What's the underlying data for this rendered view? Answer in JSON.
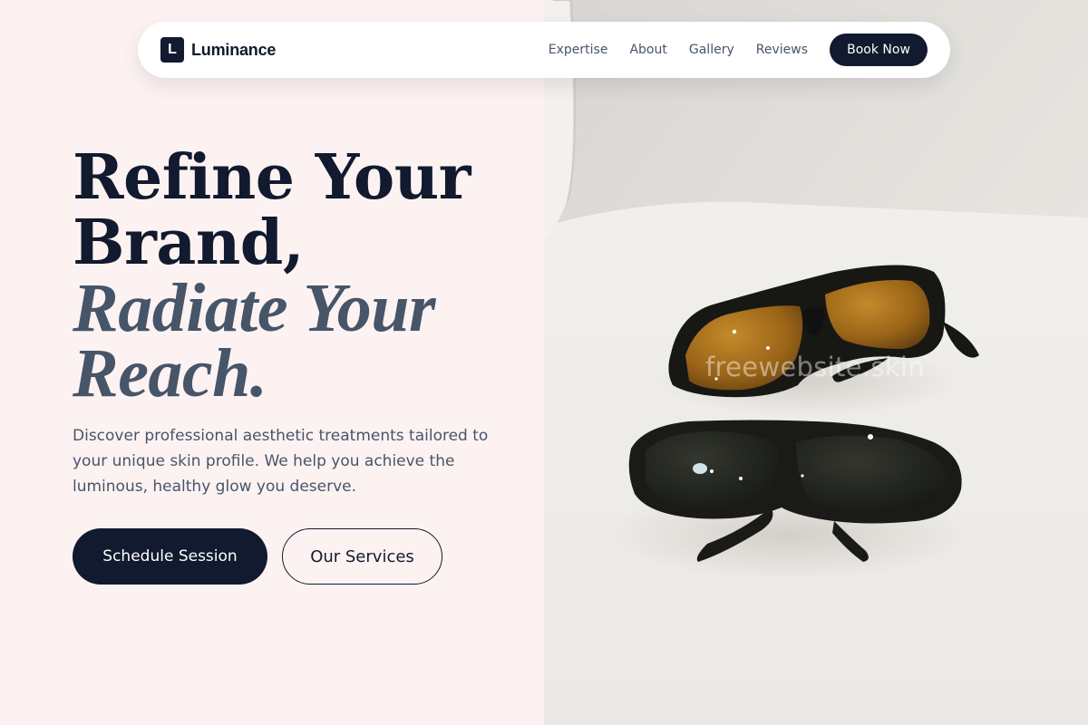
{
  "nav": {
    "logo_letter": "L",
    "brand": "Luminance",
    "links": [
      "Expertise",
      "About",
      "Gallery",
      "Reviews"
    ],
    "cta": "Book Now"
  },
  "hero": {
    "title_line1": "Refine Your",
    "title_line2": "Brand,",
    "title_line3": "Radiate Your",
    "title_line4": "Reach.",
    "description": "Discover professional aesthetic treatments tailored to your unique skin profile. We help you achieve the luminous, healthy glow you deserve.",
    "primary_button": "Schedule Session",
    "secondary_button": "Our Services"
  },
  "image": {
    "subject": "two pairs of protective goggles, amber and dark tinted, on a white surface",
    "watermark": "freewebsite.skin"
  },
  "colors": {
    "left_background": "#fdf2f2",
    "navy": "#111a2e",
    "slate": "#475569",
    "white": "#ffffff"
  }
}
